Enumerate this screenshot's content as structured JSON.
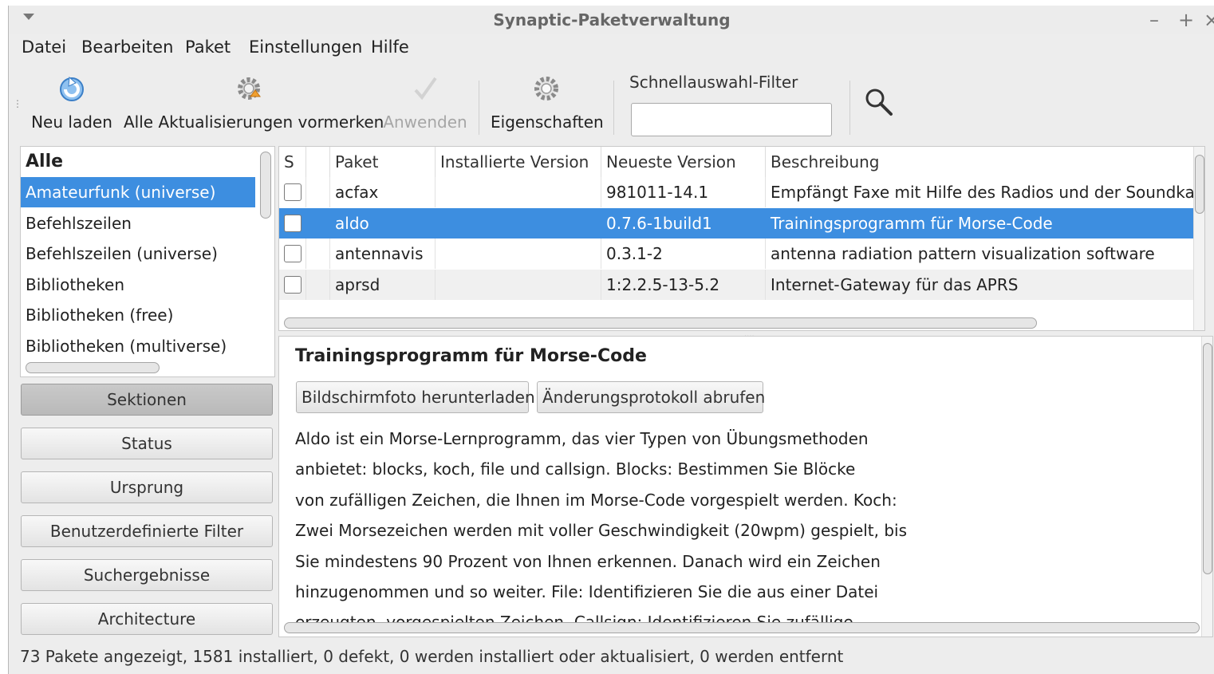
{
  "window": {
    "title": "Synaptic-Paketverwaltung",
    "minimize": "–",
    "maximize": "+",
    "close": "×"
  },
  "menu": [
    "Datei",
    "Bearbeiten",
    "Paket",
    "Einstellungen",
    "Hilfe"
  ],
  "toolbar": {
    "reload_label": "Neu laden",
    "mark_all_label": "Alle Aktualisierungen vormerken",
    "apply_label": "Anwenden",
    "properties_label": "Eigenschaften",
    "filter_label": "Schnellauswahl-Filter",
    "filter_value": ""
  },
  "sections": {
    "items": [
      "Alle",
      "Amateurfunk (universe)",
      "Befehlszeilen",
      "Befehlszeilen (universe)",
      "Bibliotheken",
      "Bibliotheken (free)",
      "Bibliotheken (multiverse)"
    ],
    "selected": "Amateurfunk (universe)"
  },
  "filter_buttons": [
    "Sektionen",
    "Status",
    "Ursprung",
    "Benutzerdefinierte Filter",
    "Suchergebnisse",
    "Architecture"
  ],
  "filter_active": "Sektionen",
  "table": {
    "columns": [
      "S",
      "Paket",
      "Installierte Version",
      "Neueste Version",
      "Beschreibung"
    ],
    "rows": [
      {
        "package": "acfax",
        "installed": "",
        "latest": "981011-14.1",
        "description": "Empfängt Faxe mit Hilfe des Radios und der Soundkarte"
      },
      {
        "package": "aldo",
        "installed": "",
        "latest": "0.7.6-1build1",
        "description": "Trainingsprogramm für Morse-Code",
        "selected": true
      },
      {
        "package": "antennavis",
        "installed": "",
        "latest": "0.3.1-2",
        "description": "antenna radiation pattern visualization software"
      },
      {
        "package": "aprsd",
        "installed": "",
        "latest": "1:2.2.5-13-5.2",
        "description": "Internet-Gateway für das APRS"
      }
    ]
  },
  "details": {
    "title": "Trainingsprogramm für Morse-Code",
    "screenshot_button": "Bildschirmfoto herunterladen",
    "changelog_button": "Änderungsprotokoll abrufen",
    "description": "Aldo ist ein Morse-Lernprogramm, das vier Typen von Übungsmethoden\nanbietet: blocks, koch, file und callsign. Blocks: Bestimmen Sie Blöcke\nvon zufälligen Zeichen, die Ihnen im Morse-Code vorgespielt werden. Koch:\nZwei Morsezeichen werden mit voller Geschwindigkeit (20wpm) gespielt, bis\nSie mindestens 90 Prozent von Ihnen erkennen. Danach wird ein Zeichen\nhinzugenommen und so weiter. File: Identifizieren Sie die aus einer Datei\nerzeugten, vorgespielten Zeichen. Callsign: Identifizieren Sie zufällige"
  },
  "status": "73 Pakete angezeigt, 1581 installiert, 0 defekt, 0 werden installiert oder aktualisiert, 0 werden entfernt",
  "colors": {
    "selection": "#3d8ee0",
    "window_bg": "#ededed"
  },
  "icons": [
    "reload-icon",
    "mark-upgrades-icon",
    "apply-icon",
    "properties-icon",
    "search-icon"
  ]
}
